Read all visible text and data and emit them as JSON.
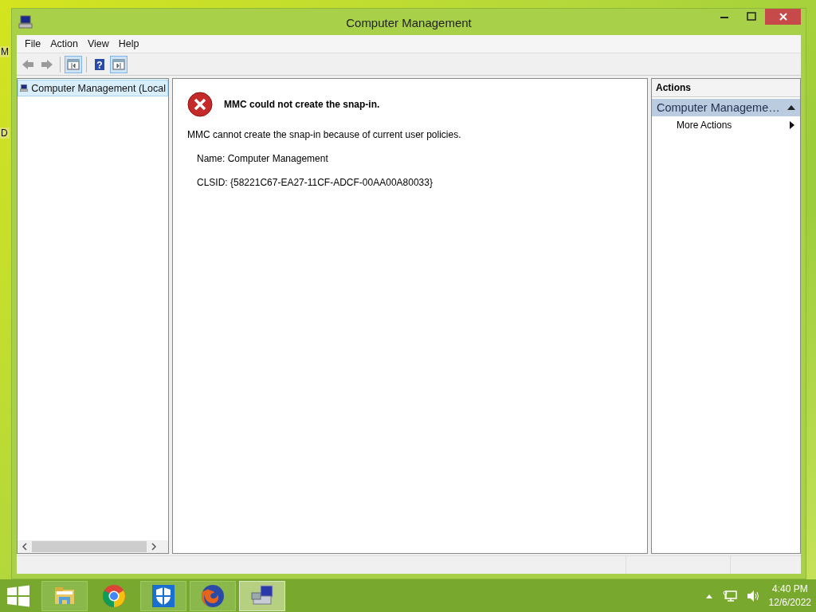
{
  "desktop_labels": [
    "M",
    "D"
  ],
  "window": {
    "title": "Computer Management"
  },
  "menu": [
    "File",
    "Action",
    "View",
    "Help"
  ],
  "toolbar": [
    {
      "kind": "back",
      "disabled": true
    },
    {
      "kind": "forward",
      "disabled": true
    },
    {
      "kind": "separator"
    },
    {
      "kind": "console-tree",
      "on": true
    },
    {
      "kind": "separator"
    },
    {
      "kind": "help",
      "glyph": "?"
    },
    {
      "kind": "action-pane",
      "on": true
    }
  ],
  "tree": [
    {
      "label": "Computer Management (Local",
      "selected": true
    }
  ],
  "error": {
    "title": "MMC could not create the snap-in.",
    "message": "MMC cannot create the snap-in because of current user policies.",
    "details": [
      "Name: Computer Management",
      "CLSID: {58221C67-EA27-11CF-ADCF-00AA00A80033}"
    ]
  },
  "actions": {
    "header": "Actions",
    "sections": [
      {
        "title": "Computer Manageme…",
        "expanded": true,
        "items": [
          {
            "label": "More Actions"
          }
        ]
      }
    ]
  },
  "taskbar": {
    "apps": [
      {
        "kind": "explorer",
        "running": true,
        "active": false
      },
      {
        "kind": "chrome",
        "running": false,
        "active": false
      },
      {
        "kind": "defender",
        "running": true,
        "active": false
      },
      {
        "kind": "firefox",
        "running": true,
        "active": false
      },
      {
        "kind": "mmc",
        "running": true,
        "active": true
      }
    ],
    "clock": {
      "time": "4:40 PM",
      "date": "12/6/2022"
    }
  }
}
